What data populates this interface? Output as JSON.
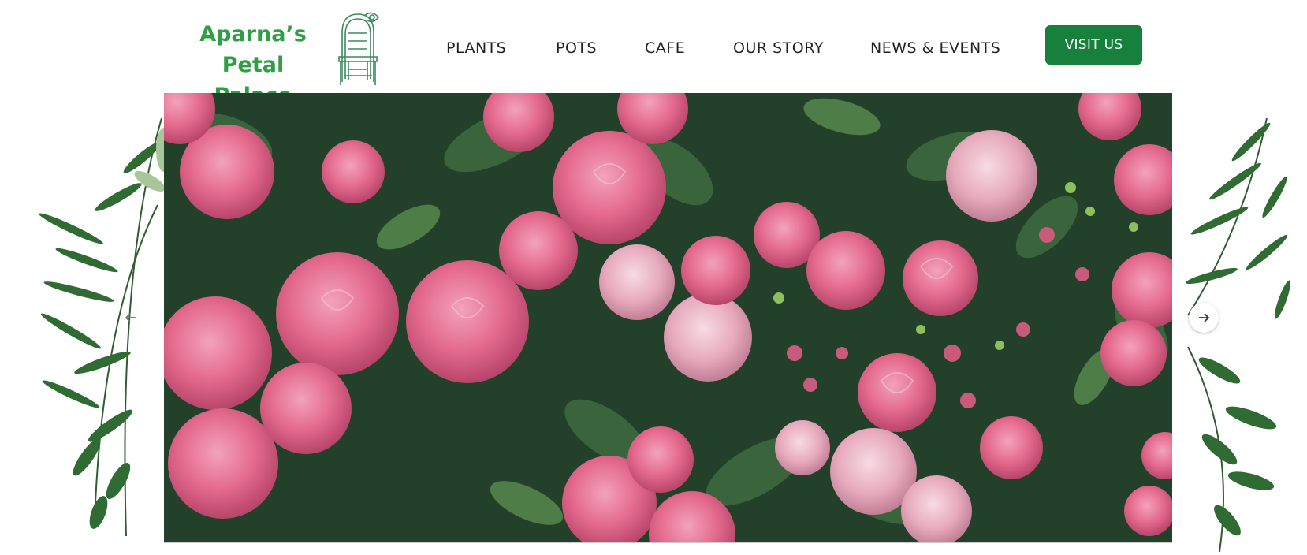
{
  "logo": {
    "line1": "Aparna’s",
    "line2": "Petal Palace",
    "emblem_icon": "chair-icon"
  },
  "nav": {
    "items": [
      {
        "label": "PLANTS"
      },
      {
        "label": "POTS"
      },
      {
        "label": "CAFE"
      },
      {
        "label": "OUR STORY"
      },
      {
        "label": "NEWS & EVENTS"
      }
    ]
  },
  "cta": {
    "label": "VISIT US"
  },
  "hero": {
    "image": "pink-roses-photo",
    "prev_icon": "arrow-left-icon",
    "next_icon": "arrow-right-icon"
  },
  "colors": {
    "brand_green": "#2ea043",
    "button_green": "#17803d",
    "rose_pink": "#e56b8e",
    "leaf_dark": "#1f4423"
  }
}
